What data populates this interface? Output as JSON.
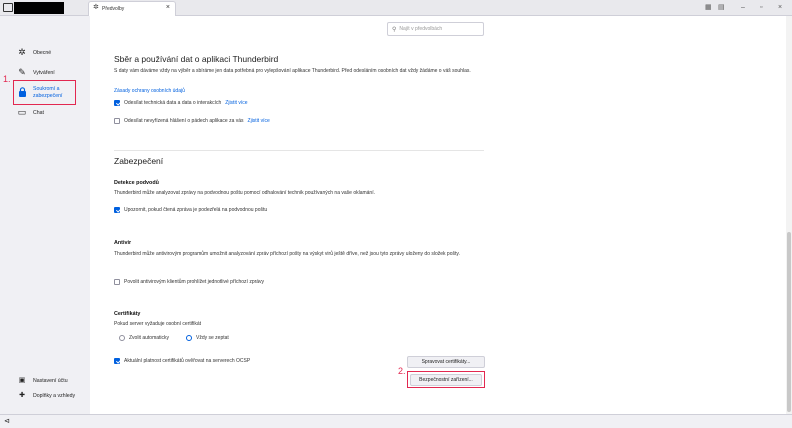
{
  "titlebar": {
    "tab_label": "Předvolby",
    "tab_close": "×",
    "window_buttons": [
      "▦",
      "▤",
      "–",
      "▫",
      "×"
    ]
  },
  "search": {
    "placeholder": "Najít v předvolbách"
  },
  "sidebar": {
    "items": [
      {
        "icon": "gear-icon",
        "glyph": "✲",
        "label": "Obecné"
      },
      {
        "icon": "pen-icon",
        "glyph": "✎",
        "label": "Vytváření"
      },
      {
        "icon": "lock-icon",
        "glyph": "🔒",
        "label": "Soukromí a zabezpečení",
        "selected": true
      },
      {
        "icon": "chat-icon",
        "glyph": "▭",
        "label": "Chat"
      }
    ],
    "bottom": [
      {
        "icon": "account-settings-icon",
        "glyph": "▣",
        "label": "Nastavení účtu"
      },
      {
        "icon": "addons-icon",
        "glyph": "✚",
        "label": "Doplňky a vzhledy"
      }
    ]
  },
  "annotations": {
    "step1": "1.",
    "step2": "2."
  },
  "data_collection": {
    "title": "Sběr a používání dat o aplikaci Thunderbird",
    "description": "S daty vám dáváme vždy na výběr a sbíráme jen data potřebná pro vylepšování aplikace Thunderbird. Před odesláním osobních dat vždy žádáme o váš souhlas.",
    "privacy_link": "Zásady ochrany osobních údajů",
    "telemetry_label": "Odesílat technická data a data o interakcích",
    "telemetry_more": "Zjistit více",
    "telemetry_checked": true,
    "crash_label": "Odesílat nevyřízená hlášení o pádech aplikace za vás",
    "crash_more": "Zjistit více",
    "crash_checked": false
  },
  "security": {
    "title": "Zabezpečení",
    "scam": {
      "heading": "Detekce podvodů",
      "description": "Thunderbird může analyzovat zprávy na podvodnou poštu pomocí odhalování technik používaných na vaše oklamání.",
      "checkbox_label": "Upozornit, pokud čtená zpráva je podezřelá na podvodnou poštu",
      "checked": true
    },
    "antivirus": {
      "heading": "Antivir",
      "description": "Thunderbird může antivirovým programům umožnit analyzování zpráv příchozí pošty na výskyt virů ještě dříve, než jsou tyto zprávy uloženy do složek pošty.",
      "checkbox_label": "Povolit antivirovým klientům prohlížet jednotlivé příchozí zprávy",
      "checked": false
    },
    "certificates": {
      "heading": "Certifikáty",
      "prompt": "Pokud server vyžaduje osobní certifikát",
      "radio_auto": "Zvolit automaticky",
      "radio_ask": "Vždy se zeptat",
      "selected": "ask",
      "ocsp_label": "Aktuální platnost certifikátů ověřovat na serverech OCSP",
      "ocsp_checked": true,
      "manage_button": "Spravovat certifikáty...",
      "devices_button": "Bezpečnostní zařízení..."
    }
  },
  "statusbar": {
    "icon": "activity-icon",
    "glyph": "⊲"
  },
  "colors": {
    "accent": "#0060df",
    "annotation": "#e22850"
  }
}
